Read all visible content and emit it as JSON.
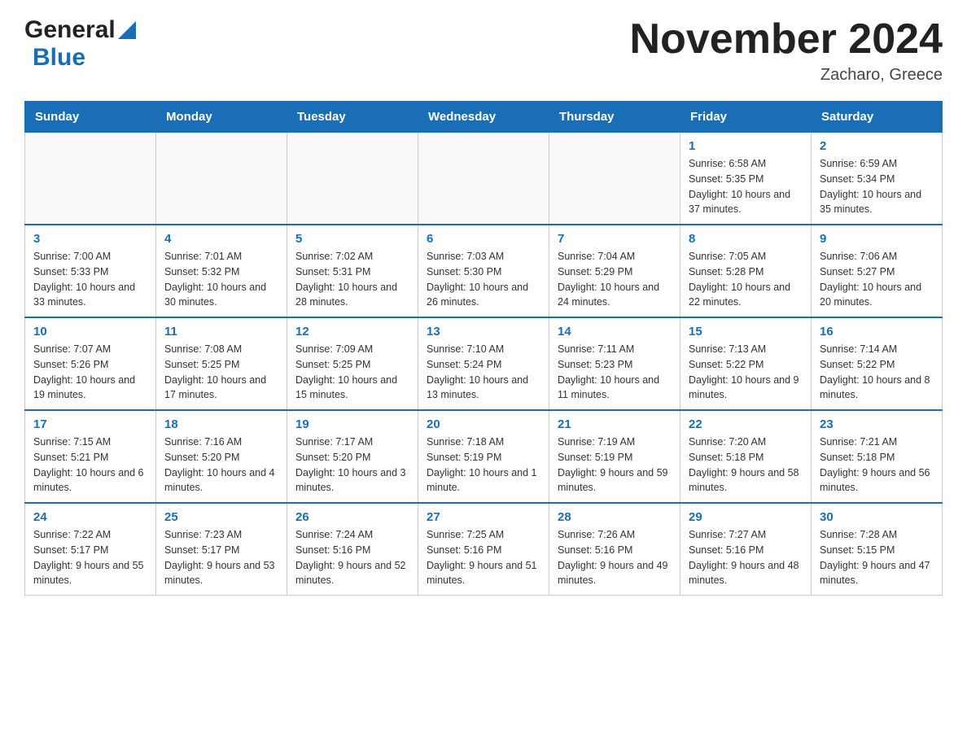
{
  "header": {
    "month_title": "November 2024",
    "location": "Zacharo, Greece",
    "logo_general": "General",
    "logo_blue": "Blue"
  },
  "days_of_week": [
    "Sunday",
    "Monday",
    "Tuesday",
    "Wednesday",
    "Thursday",
    "Friday",
    "Saturday"
  ],
  "weeks": [
    [
      {
        "day": "",
        "info": ""
      },
      {
        "day": "",
        "info": ""
      },
      {
        "day": "",
        "info": ""
      },
      {
        "day": "",
        "info": ""
      },
      {
        "day": "",
        "info": ""
      },
      {
        "day": "1",
        "info": "Sunrise: 6:58 AM\nSunset: 5:35 PM\nDaylight: 10 hours and 37 minutes."
      },
      {
        "day": "2",
        "info": "Sunrise: 6:59 AM\nSunset: 5:34 PM\nDaylight: 10 hours and 35 minutes."
      }
    ],
    [
      {
        "day": "3",
        "info": "Sunrise: 7:00 AM\nSunset: 5:33 PM\nDaylight: 10 hours and 33 minutes."
      },
      {
        "day": "4",
        "info": "Sunrise: 7:01 AM\nSunset: 5:32 PM\nDaylight: 10 hours and 30 minutes."
      },
      {
        "day": "5",
        "info": "Sunrise: 7:02 AM\nSunset: 5:31 PM\nDaylight: 10 hours and 28 minutes."
      },
      {
        "day": "6",
        "info": "Sunrise: 7:03 AM\nSunset: 5:30 PM\nDaylight: 10 hours and 26 minutes."
      },
      {
        "day": "7",
        "info": "Sunrise: 7:04 AM\nSunset: 5:29 PM\nDaylight: 10 hours and 24 minutes."
      },
      {
        "day": "8",
        "info": "Sunrise: 7:05 AM\nSunset: 5:28 PM\nDaylight: 10 hours and 22 minutes."
      },
      {
        "day": "9",
        "info": "Sunrise: 7:06 AM\nSunset: 5:27 PM\nDaylight: 10 hours and 20 minutes."
      }
    ],
    [
      {
        "day": "10",
        "info": "Sunrise: 7:07 AM\nSunset: 5:26 PM\nDaylight: 10 hours and 19 minutes."
      },
      {
        "day": "11",
        "info": "Sunrise: 7:08 AM\nSunset: 5:25 PM\nDaylight: 10 hours and 17 minutes."
      },
      {
        "day": "12",
        "info": "Sunrise: 7:09 AM\nSunset: 5:25 PM\nDaylight: 10 hours and 15 minutes."
      },
      {
        "day": "13",
        "info": "Sunrise: 7:10 AM\nSunset: 5:24 PM\nDaylight: 10 hours and 13 minutes."
      },
      {
        "day": "14",
        "info": "Sunrise: 7:11 AM\nSunset: 5:23 PM\nDaylight: 10 hours and 11 minutes."
      },
      {
        "day": "15",
        "info": "Sunrise: 7:13 AM\nSunset: 5:22 PM\nDaylight: 10 hours and 9 minutes."
      },
      {
        "day": "16",
        "info": "Sunrise: 7:14 AM\nSunset: 5:22 PM\nDaylight: 10 hours and 8 minutes."
      }
    ],
    [
      {
        "day": "17",
        "info": "Sunrise: 7:15 AM\nSunset: 5:21 PM\nDaylight: 10 hours and 6 minutes."
      },
      {
        "day": "18",
        "info": "Sunrise: 7:16 AM\nSunset: 5:20 PM\nDaylight: 10 hours and 4 minutes."
      },
      {
        "day": "19",
        "info": "Sunrise: 7:17 AM\nSunset: 5:20 PM\nDaylight: 10 hours and 3 minutes."
      },
      {
        "day": "20",
        "info": "Sunrise: 7:18 AM\nSunset: 5:19 PM\nDaylight: 10 hours and 1 minute."
      },
      {
        "day": "21",
        "info": "Sunrise: 7:19 AM\nSunset: 5:19 PM\nDaylight: 9 hours and 59 minutes."
      },
      {
        "day": "22",
        "info": "Sunrise: 7:20 AM\nSunset: 5:18 PM\nDaylight: 9 hours and 58 minutes."
      },
      {
        "day": "23",
        "info": "Sunrise: 7:21 AM\nSunset: 5:18 PM\nDaylight: 9 hours and 56 minutes."
      }
    ],
    [
      {
        "day": "24",
        "info": "Sunrise: 7:22 AM\nSunset: 5:17 PM\nDaylight: 9 hours and 55 minutes."
      },
      {
        "day": "25",
        "info": "Sunrise: 7:23 AM\nSunset: 5:17 PM\nDaylight: 9 hours and 53 minutes."
      },
      {
        "day": "26",
        "info": "Sunrise: 7:24 AM\nSunset: 5:16 PM\nDaylight: 9 hours and 52 minutes."
      },
      {
        "day": "27",
        "info": "Sunrise: 7:25 AM\nSunset: 5:16 PM\nDaylight: 9 hours and 51 minutes."
      },
      {
        "day": "28",
        "info": "Sunrise: 7:26 AM\nSunset: 5:16 PM\nDaylight: 9 hours and 49 minutes."
      },
      {
        "day": "29",
        "info": "Sunrise: 7:27 AM\nSunset: 5:16 PM\nDaylight: 9 hours and 48 minutes."
      },
      {
        "day": "30",
        "info": "Sunrise: 7:28 AM\nSunset: 5:15 PM\nDaylight: 9 hours and 47 minutes."
      }
    ]
  ]
}
